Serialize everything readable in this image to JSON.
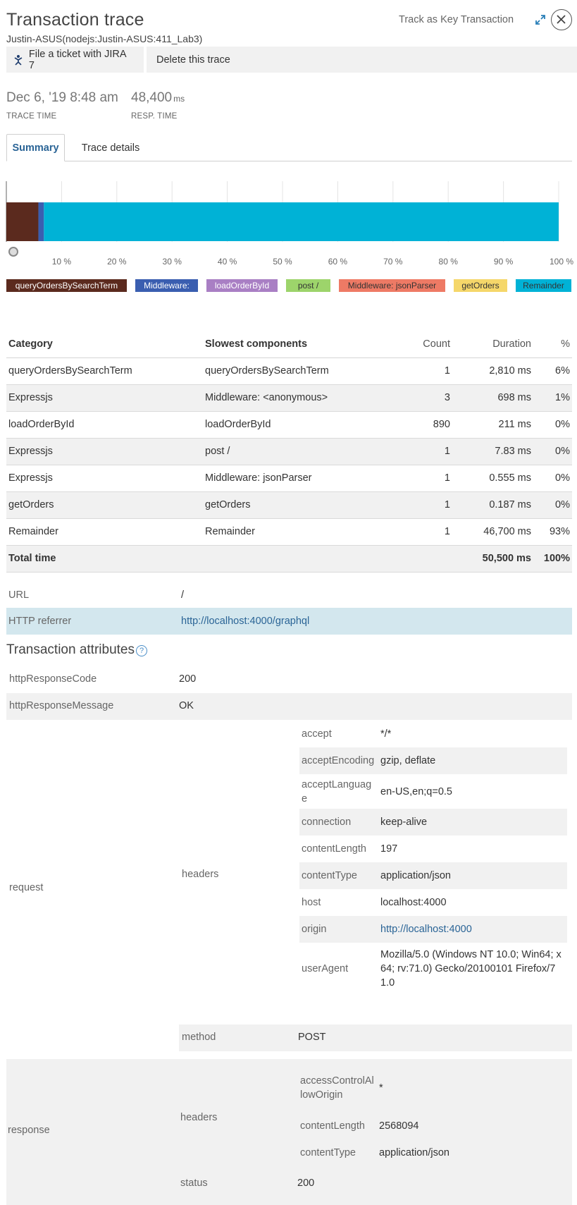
{
  "header": {
    "title": "Transaction trace",
    "subtitle": "Justin-ASUS(nodejs:Justin-ASUS:411_Lab3)",
    "key_transaction_label": "Track as Key Transaction"
  },
  "toolbar": {
    "jira_label": "File a ticket with JIRA 7",
    "delete_label": "Delete this trace"
  },
  "stats": {
    "trace_time_value": "Dec 6, '19 8:48 am",
    "trace_time_label": "TRACE TIME",
    "resp_time_value": "48,400",
    "resp_time_unit": "ms",
    "resp_time_label": "RESP. TIME"
  },
  "tabs": {
    "summary": "Summary",
    "trace_details": "Trace details"
  },
  "chart_data": {
    "type": "bar",
    "orientation": "horizontal-stacked",
    "x_ticks": [
      "10 %",
      "20 %",
      "30 %",
      "40 %",
      "50 %",
      "60 %",
      "70 %",
      "80 %",
      "90 %",
      "100 %"
    ],
    "xlim": [
      0,
      100
    ],
    "segments": [
      {
        "name": "queryOrdersBySearchTerm",
        "value": 5.8,
        "color": "#5b2a1e"
      },
      {
        "name": "Middleware:",
        "value": 1.0,
        "color": "#3a5eb0"
      },
      {
        "name": "Remainder",
        "value": 93.2,
        "color": "#00b2d6"
      }
    ],
    "legend": [
      {
        "label": "queryOrdersBySearchTerm",
        "color": "#5b2a1e",
        "text_color": "#ffffff"
      },
      {
        "label": "Middleware:",
        "color": "#3a5eb0",
        "text_color": "#ffffff"
      },
      {
        "label": "loadOrderById",
        "color": "#a97fc4",
        "text_color": "#ffffff"
      },
      {
        "label": "post /",
        "color": "#9dd46b",
        "text_color": "#333333"
      },
      {
        "label": "Middleware: jsonParser",
        "color": "#ee7a65",
        "text_color": "#333333"
      },
      {
        "label": "getOrders",
        "color": "#f5d76a",
        "text_color": "#333333"
      },
      {
        "label": "Remainder",
        "color": "#00b2d6",
        "text_color": "#333333"
      }
    ]
  },
  "breakdown": {
    "headers": {
      "category": "Category",
      "slowest": "Slowest components",
      "count": "Count",
      "duration": "Duration",
      "percent": "%"
    },
    "rows": [
      {
        "category": "queryOrdersBySearchTerm",
        "component": "queryOrdersBySearchTerm",
        "count": "1",
        "duration": "2,810 ms",
        "percent": "6%"
      },
      {
        "category": "Expressjs",
        "component": "Middleware: <anonymous>",
        "count": "3",
        "duration": "698 ms",
        "percent": "1%"
      },
      {
        "category": "loadOrderById",
        "component": "loadOrderById",
        "count": "890",
        "duration": "211 ms",
        "percent": "0%"
      },
      {
        "category": "Expressjs",
        "component": "post /",
        "count": "1",
        "duration": "7.83 ms",
        "percent": "0%"
      },
      {
        "category": "Expressjs",
        "component": "Middleware: jsonParser",
        "count": "1",
        "duration": "0.555 ms",
        "percent": "0%"
      },
      {
        "category": "getOrders",
        "component": "getOrders",
        "count": "1",
        "duration": "0.187 ms",
        "percent": "0%"
      },
      {
        "category": "Remainder",
        "component": "Remainder",
        "count": "1",
        "duration": "46,700 ms",
        "percent": "93%"
      }
    ],
    "total": {
      "label": "Total time",
      "duration": "50,500 ms",
      "percent": "100%"
    }
  },
  "request_info": {
    "url_label": "URL",
    "url_value": "/",
    "referrer_label": "HTTP referrer",
    "referrer_value": "http://localhost:4000/graphql"
  },
  "attributes": {
    "title": "Transaction attributes",
    "help": "?",
    "rows": [
      {
        "key": "httpResponseCode",
        "value": "200"
      },
      {
        "key": "httpResponseMessage",
        "value": "OK"
      }
    ],
    "request": {
      "label": "request",
      "headers_label": "headers",
      "headers": [
        {
          "key": "accept",
          "value": "*/*"
        },
        {
          "key": "acceptEncoding",
          "value": "gzip, deflate"
        },
        {
          "key": "acceptLanguag\ne",
          "value": "en-US,en;q=0.5"
        },
        {
          "key": "connection",
          "value": "keep-alive"
        },
        {
          "key": "contentLength",
          "value": "197"
        },
        {
          "key": "contentType",
          "value": "application/json"
        },
        {
          "key": "host",
          "value": "localhost:4000"
        },
        {
          "key": "origin",
          "value": "http://localhost:4000"
        },
        {
          "key": "userAgent",
          "value": "Mozilla/5.0 (Windows NT 10.0; Win64; x\n64; rv:71.0) Gecko/20100101 Firefox/7\n1.0"
        }
      ],
      "method_label": "method",
      "method_value": "POST"
    },
    "response": {
      "label": "response",
      "headers_label": "headers",
      "headers": [
        {
          "key": "accessControlAl\nlowOrigin",
          "value": "*"
        },
        {
          "key": "contentLength",
          "value": "2568094"
        },
        {
          "key": "contentType",
          "value": "application/json"
        }
      ],
      "status_label": "status",
      "status_value": "200"
    }
  }
}
